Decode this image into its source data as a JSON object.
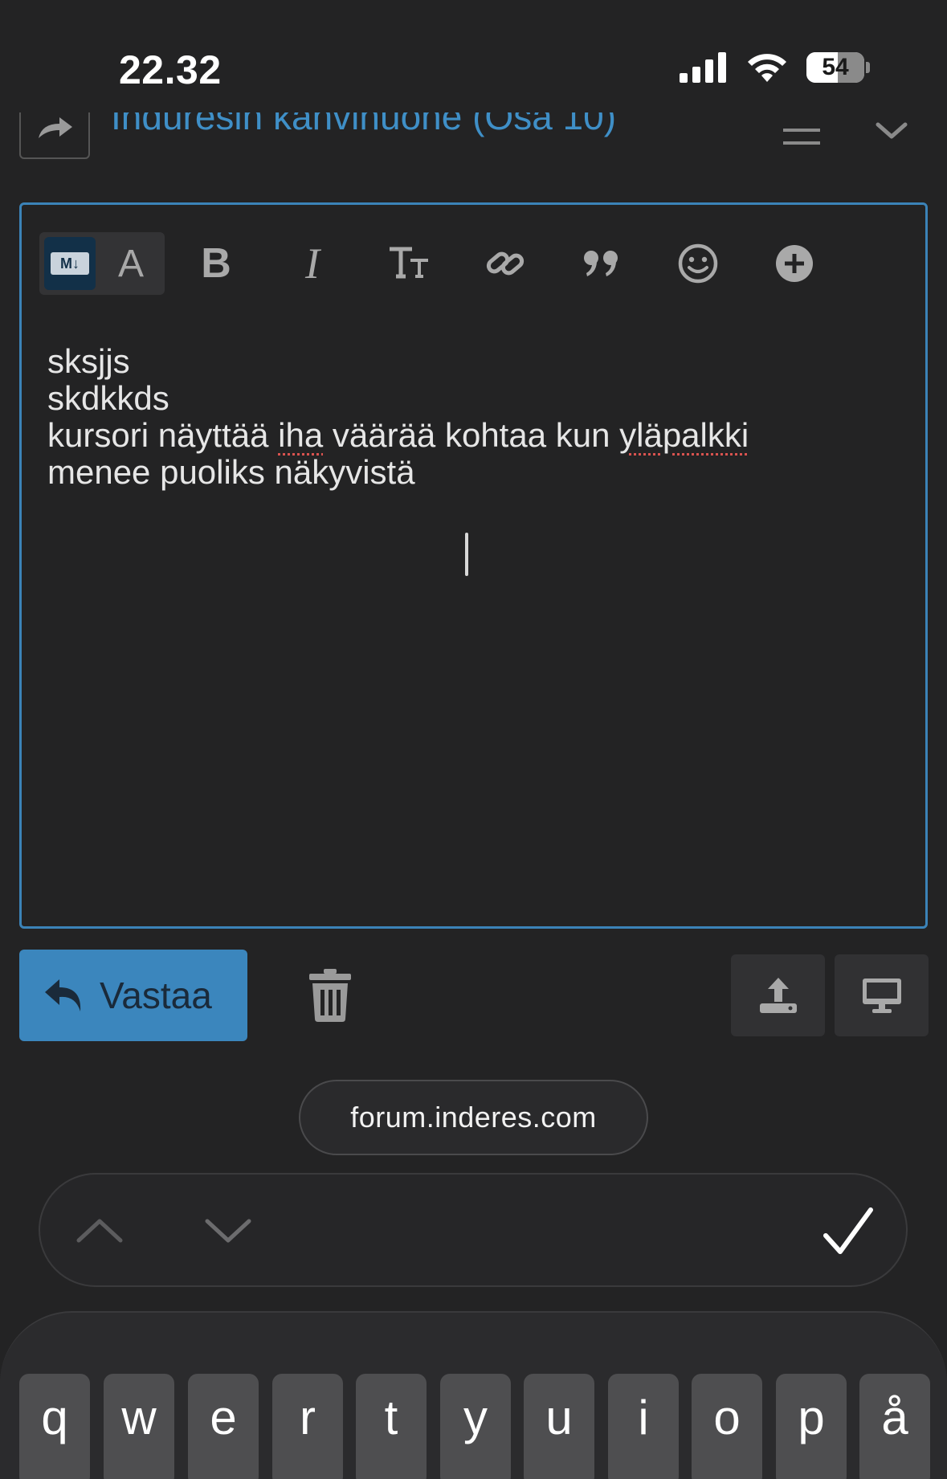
{
  "status_bar": {
    "time": "22.32",
    "battery_level": "54"
  },
  "topic": {
    "title": "Induresin kahvihuone (Osa 10)",
    "accent_color": "#3f8fc7"
  },
  "toolbar": {
    "markdown_badge": "M↓",
    "rich_text_label": "A",
    "bold_label": "B",
    "italic_label": "I",
    "heading_label": "TT"
  },
  "editor": {
    "lines": [
      "sksjjs",
      "skdkkds"
    ],
    "line3_part1": "kursori näyttää ",
    "line3_misspelled1": "iha",
    "line3_part2": " väärää kohtaa kun ",
    "line3_misspelled2": "yläpalkki",
    "line4": "menee puoliks näkyvistä",
    "border_color": "#3b83b8"
  },
  "actions": {
    "reply_label": "Vastaa",
    "reply_color": "#3b86bd"
  },
  "browser": {
    "url": "forum.inderes.com"
  },
  "keyboard": {
    "row1": [
      "q",
      "w",
      "e",
      "r",
      "t",
      "y",
      "u",
      "i",
      "o",
      "p",
      "å"
    ]
  }
}
